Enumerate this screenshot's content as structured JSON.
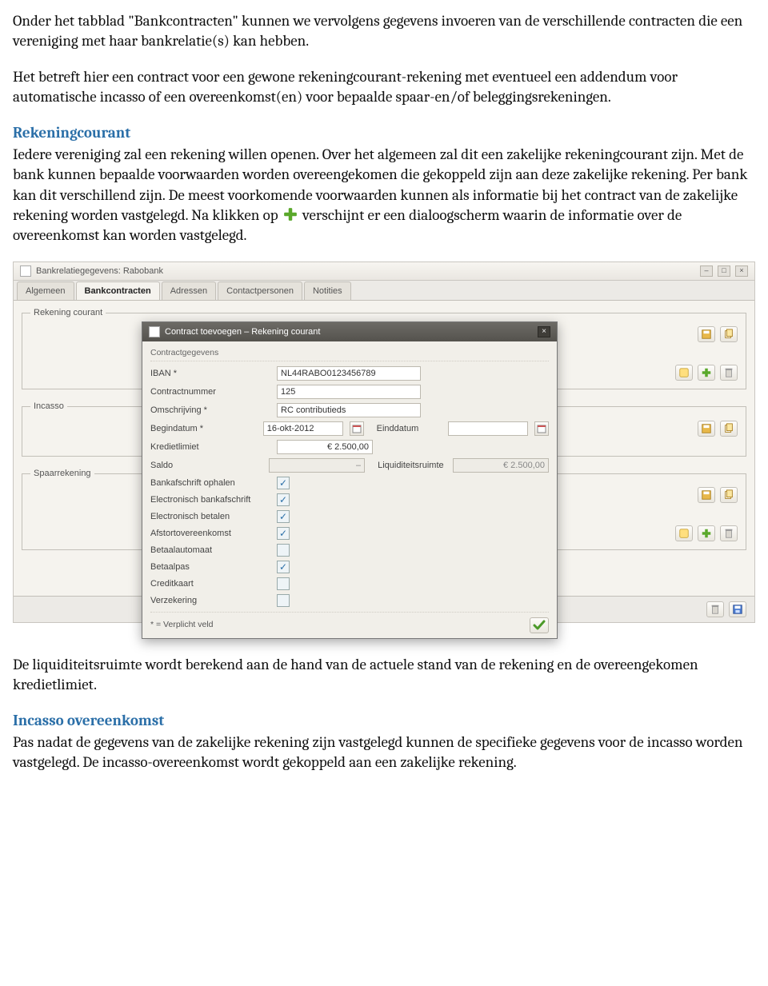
{
  "doc": {
    "p1": "Onder het tabblad \"Bankcontracten\" kunnen we vervolgens gegevens invoeren van de verschillende contracten die een vereniging met haar bankrelatie(s) kan hebben.",
    "p2": "Het betreft hier een contract voor een gewone rekeningcourant-rekening met eventueel een addendum voor automatische incasso of een overeenkomst(en) voor bepaalde spaar-en/of beleggingsrekeningen.",
    "h1": "Rekeningcourant",
    "p3a": "Iedere vereniging zal een rekening willen openen. Over het algemeen zal dit een zakelijke rekeningcourant zijn. Met de bank kunnen bepaalde voorwaarden worden overeengekomen die gekoppeld zijn aan deze zakelijke rekening. Per bank kan dit verschillend zijn. De meest voorkomende voorwaarden kunnen als informatie bij het contract van de zakelijke rekening worden vastgelegd. Na klikken op ",
    "p3b": " verschijnt er een dialoogscherm waarin de informatie over de overeenkomst kan worden vastgelegd.",
    "p4": "De liquiditeitsruimte wordt berekend aan de hand van de actuele stand van de rekening en de overeengekomen kredietlimiet.",
    "h2": "Incasso overeenkomst",
    "p5": "Pas nadat de gegevens van de zakelijke rekening zijn vastgelegd kunnen de specifieke gegevens voor de incasso worden vastgelegd. De incasso-overeenkomst wordt gekoppeld aan een zakelijke rekening."
  },
  "ss": {
    "window_title": "Bankrelatiegegevens: Rabobank",
    "tabs": [
      "Algemeen",
      "Bankcontracten",
      "Adressen",
      "Contactpersonen",
      "Notities"
    ],
    "active_tab": 1,
    "groups": {
      "rc": "Rekening courant",
      "incasso": "Incasso",
      "spaar": "Spaarrekening"
    }
  },
  "dlg": {
    "title": "Contract toevoegen – Rekening courant",
    "section": "Contractgegevens",
    "labels": {
      "iban": "IBAN *",
      "contractnr": "Contractnummer",
      "omschrijving": "Omschrijving *",
      "begindatum": "Begindatum *",
      "einddatum": "Einddatum",
      "kredietlimiet": "Kredietlimiet",
      "saldo": "Saldo",
      "liquiditeit": "Liquiditeitsruimte",
      "bank_ophalen": "Bankafschrift ophalen",
      "ebank": "Electronisch bankafschrift",
      "ebetalen": "Electronisch betalen",
      "afstort": "Afstortovereenkomst",
      "betaalautomaat": "Betaalautomaat",
      "betaalpas": "Betaalpas",
      "creditkaart": "Creditkaart",
      "verzekering": "Verzekering"
    },
    "values": {
      "iban": "NL44RABO0123456789",
      "contractnr": "125",
      "omschrijving": "RC contributieds",
      "begindatum": "16-okt-2012",
      "einddatum": "",
      "kredietlimiet": "€ 2.500,00",
      "saldo": "–",
      "liquiditeit": "€ 2.500,00"
    },
    "checks": {
      "bank_ophalen": true,
      "ebank": true,
      "ebetalen": true,
      "afstort": true,
      "betaalautomaat": false,
      "betaalpas": true,
      "creditkaart": false,
      "verzekering": false
    },
    "required_note": "* = Verplicht veld"
  }
}
